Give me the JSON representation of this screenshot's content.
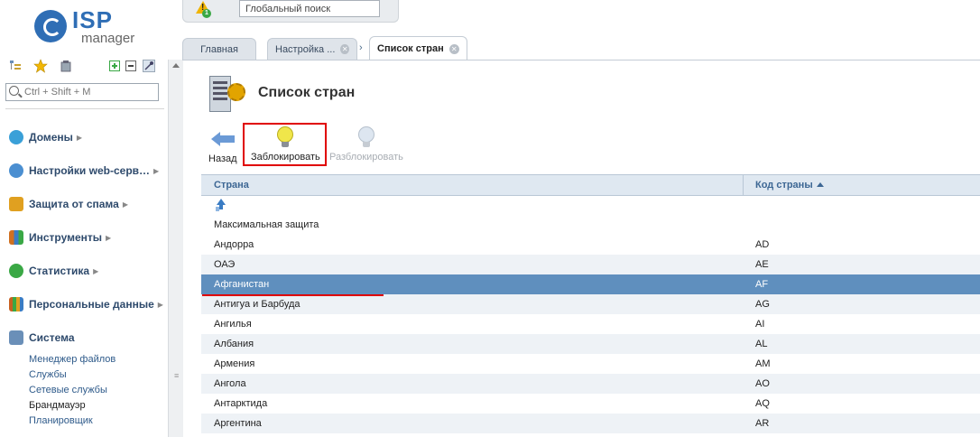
{
  "logo": {
    "isp": "ISP",
    "manager": "manager"
  },
  "sidebar": {
    "search_placeholder": "Ctrl + Shift + M",
    "menu": [
      {
        "label": "Домены",
        "icon": "globe-icon",
        "color": "#3aa0d8"
      },
      {
        "label": "Настройки web-серв…",
        "icon": "globe-gear-icon",
        "color": "#4b8fd1"
      },
      {
        "label": "Защита от спама",
        "icon": "shield-icon",
        "color": "#e0a020"
      },
      {
        "label": "Инструменты",
        "icon": "tools-icon",
        "color": "#d07020"
      },
      {
        "label": "Статистика",
        "icon": "chart-icon",
        "color": "#3aa845"
      },
      {
        "label": "Персональные данные",
        "icon": "bars-icon",
        "color": "#c86020"
      },
      {
        "label": "Система",
        "icon": "system-icon",
        "color": "#6a8fb8"
      }
    ],
    "system_items": [
      "Менеджер файлов",
      "Службы",
      "Сетевые службы",
      "Брандмауэр",
      "Планировщик"
    ]
  },
  "topbar": {
    "search_value": "Глобальный поиск",
    "alert_count": "1"
  },
  "tabs": [
    {
      "label": "Главная"
    },
    {
      "label": "Настройка ..."
    },
    {
      "label": "Список стран"
    }
  ],
  "page": {
    "title": "Список стран"
  },
  "toolbar": {
    "back": "Назад",
    "block": "Заблокировать",
    "unblock": "Разблокировать"
  },
  "table": {
    "columns": [
      "Страна",
      "Код страны"
    ],
    "rows": [
      {
        "country": "Максимальная защита",
        "code": ""
      },
      {
        "country": "Андорра",
        "code": "AD"
      },
      {
        "country": "ОАЭ",
        "code": "AE"
      },
      {
        "country": "Афганистан",
        "code": "AF"
      },
      {
        "country": "Антигуа и Барбуда",
        "code": "AG"
      },
      {
        "country": "Ангилья",
        "code": "AI"
      },
      {
        "country": "Албания",
        "code": "AL"
      },
      {
        "country": "Армения",
        "code": "AM"
      },
      {
        "country": "Ангола",
        "code": "AO"
      },
      {
        "country": "Антарктида",
        "code": "AQ"
      },
      {
        "country": "Аргентина",
        "code": "AR"
      }
    ]
  },
  "colors": {
    "accent": "#2f6eb5",
    "selected_row": "#5f8fbe",
    "annotation": "#e00000"
  }
}
